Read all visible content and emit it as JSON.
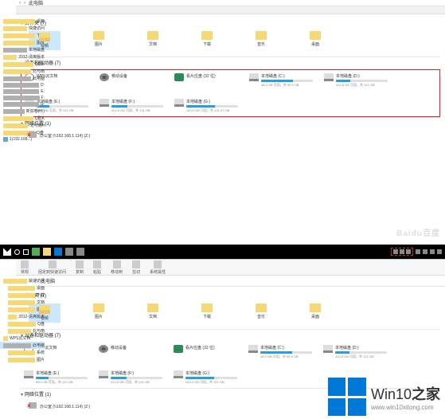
{
  "shot1": {
    "title": "此电脑",
    "breadcrumb_arrow": "›",
    "tree": [
      {
        "label": "桌面",
        "ico": "folder"
      },
      {
        "label": "快捷访问",
        "ico": "folder"
      },
      {
        "label": "下载",
        "ico": "folder"
      },
      {
        "label": "图片",
        "ico": "folder"
      },
      {
        "label": "本地磁盘",
        "ico": "drive"
      },
      {
        "label": "2012-清爽版本",
        "ico": "folder"
      },
      {
        "label": "Q群K",
        "ico": "folder"
      },
      {
        "label": "北与南",
        "ico": "folder"
      },
      {
        "label": "此电脑",
        "ico": "drive"
      },
      {
        "label": "D:",
        "ico": "drive"
      },
      {
        "label": "E:",
        "ico": "drive"
      },
      {
        "label": "F:",
        "ico": "drive"
      },
      {
        "label": "G:",
        "ico": "drive"
      },
      {
        "label": "新加卷(H:)",
        "ico": "drive"
      },
      {
        "label": "Q群K",
        "ico": "folder"
      },
      {
        "label": "北与南H",
        "ico": "folder"
      },
      {
        "label": "Q盘",
        "ico": "folder"
      },
      {
        "label": "1(192.168...)",
        "ico": "net"
      }
    ],
    "sections": {
      "folders_hdr": "文件夹 (7)",
      "drives_hdr": "设备和驱动器 (7)",
      "net_hdr": "网络位置 (1)"
    },
    "folders": [
      {
        "label": "视频",
        "ico": "video",
        "selected": true
      },
      {
        "label": "图片",
        "ico": "folder"
      },
      {
        "label": "文档",
        "ico": "folder"
      },
      {
        "label": "下载",
        "ico": "folder"
      },
      {
        "label": "音乐",
        "ico": "folder"
      },
      {
        "label": "桌面",
        "ico": "folder"
      }
    ],
    "drives": [
      {
        "name": "WPS云文档",
        "ico": "cloud",
        "bar": 0,
        "sub": ""
      },
      {
        "name": "移动设备",
        "ico": "external",
        "bar": 0,
        "sub": ""
      },
      {
        "name": "看片应盘 (32 位)",
        "ico": "media",
        "bar": 0,
        "sub": ""
      },
      {
        "name": "本地磁盘 (C:)",
        "ico": "local",
        "bar": 62,
        "sub": "38.9 GB 可用，共 99.9 GB"
      },
      {
        "name": "本地磁盘 (D:)",
        "ico": "local",
        "bar": 28,
        "sub": "412.6 GB 可用，共 121 GB"
      },
      {
        "name": "本地磁盘 (E:)",
        "ico": "local",
        "bar": 24,
        "sub": "98.0 GB 可用，共 121 GB"
      },
      {
        "name": "本地磁盘 (F:)",
        "ico": "local",
        "bar": 30,
        "sub": "412.6 GB 可用，共 121 GB"
      },
      {
        "name": "本地磁盘 (G:)",
        "ico": "local",
        "bar": 55,
        "sub": "163.0 GB 可用，共 121.07 GB"
      }
    ],
    "netloc": {
      "label": "办公室 (\\\\192.168.1.114) (Z:)"
    },
    "watermark": "Baidu百度"
  },
  "shot2": {
    "ribbon": [
      "常规",
      "固定到快速访问",
      "复制",
      "粘贴",
      "移动到",
      "剪切",
      "系统属性"
    ],
    "breadcrumb": "此电脑",
    "tree": [
      {
        "label": "快速访问",
        "ico": "folder"
      },
      {
        "label": "桌面",
        "ico": "folder",
        "indent": true
      },
      {
        "label": "下载",
        "ico": "folder",
        "indent": true
      },
      {
        "label": "文档",
        "ico": "folder",
        "indent": true
      },
      {
        "label": "图片",
        "ico": "folder",
        "indent": true
      },
      {
        "label": "2012-清爽版本",
        "ico": "folder",
        "indent": true
      },
      {
        "label": "Q盘",
        "ico": "folder",
        "indent": true
      },
      {
        "label": "北与南",
        "ico": "folder",
        "indent": true
      },
      {
        "label": "WPS云文档",
        "ico": "cloud"
      },
      {
        "label": "此电脑",
        "ico": "drive",
        "active": true
      },
      {
        "label": "系统",
        "ico": "folder",
        "indent": true
      },
      {
        "label": "图片",
        "ico": "folder",
        "indent": true
      }
    ],
    "sections": {
      "folders_hdr": "文件夹 (7)",
      "drives_hdr": "设备和驱动器 (7)",
      "net_hdr": "网络位置 (1)"
    },
    "folders": [
      {
        "label": "视频",
        "ico": "video",
        "selected": true
      },
      {
        "label": "图片",
        "ico": "folder"
      },
      {
        "label": "文档",
        "ico": "folder"
      },
      {
        "label": "下载",
        "ico": "folder"
      },
      {
        "label": "音乐",
        "ico": "folder"
      },
      {
        "label": "桌面",
        "ico": "folder"
      }
    ],
    "drives": [
      {
        "name": "WPS云文档",
        "ico": "cloud",
        "bar": 0,
        "sub": ""
      },
      {
        "name": "移动设备",
        "ico": "external",
        "bar": 0,
        "sub": ""
      },
      {
        "name": "看片应盘 (32 位)",
        "ico": "media",
        "bar": 0,
        "sub": ""
      },
      {
        "name": "本地磁盘 (C:)",
        "ico": "local",
        "bar": 62,
        "sub": "38.9 GB 可用，共 99.9 GB"
      },
      {
        "name": "本地磁盘 (D:)",
        "ico": "local",
        "bar": 28,
        "sub": "412.6 GB 可用，共 121 GB"
      },
      {
        "name": "本地磁盘 (E:)",
        "ico": "local",
        "bar": 24,
        "sub": "98.0 GB 可用，共 121 GB"
      },
      {
        "name": "本地磁盘 (F:)",
        "ico": "local",
        "bar": 30,
        "sub": "412.6 GB 可用，共 121 GB"
      },
      {
        "name": "本地磁盘 (G:)",
        "ico": "local",
        "bar": 55,
        "sub": "163.0 GB 可用，共 121 GB"
      }
    ],
    "netloc": {
      "label": "办公室 (\\\\192.168.1.114) (Z:)"
    }
  },
  "logo": {
    "main_before": "Win10",
    "main_bold": "之家",
    "url": "www.win10xitong.com"
  }
}
